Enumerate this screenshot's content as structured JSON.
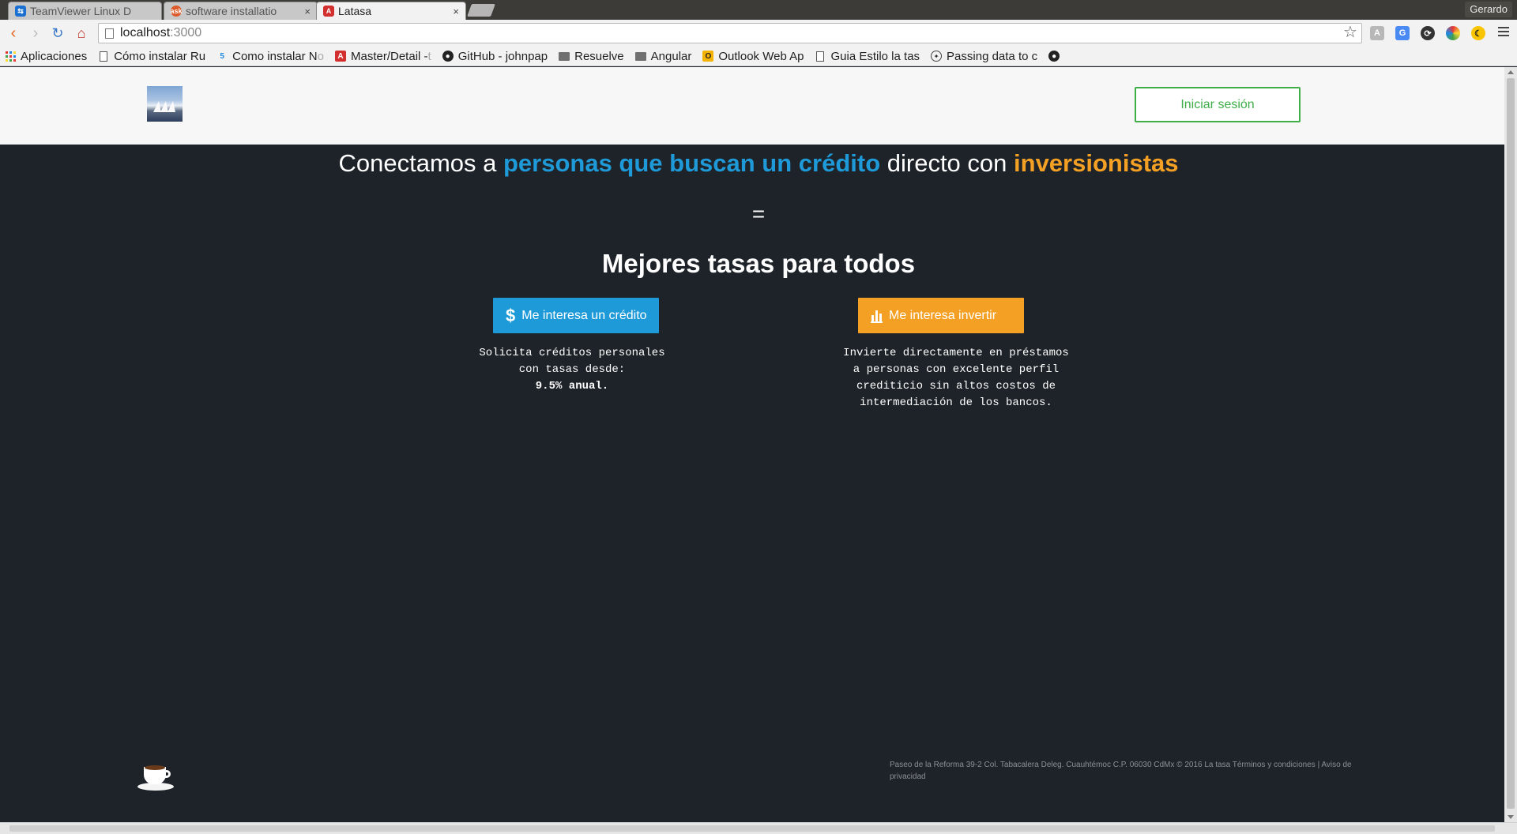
{
  "browser": {
    "tabs": [
      {
        "title": "TeamViewer Linux D",
        "icon": "teamviewer-icon",
        "active": false
      },
      {
        "title": "software installatio",
        "icon": "askubuntu-icon",
        "active": false
      },
      {
        "title": "Latasa",
        "icon": "angular-icon",
        "active": true
      }
    ],
    "tab_close": "×",
    "user": "Gerardo",
    "url_host": "localhost",
    "url_port": ":3000",
    "bookmarks": [
      {
        "label": "Aplicaciones",
        "faded": "",
        "icon": "apps-grid-icon"
      },
      {
        "label": "Cómo instalar Ru",
        "faded": "",
        "icon": "page-icon"
      },
      {
        "label": "Como instalar N",
        "faded": "o",
        "icon": "bookmark-icon"
      },
      {
        "label": "Master/Detail - ",
        "faded": "t",
        "icon": "angular-icon"
      },
      {
        "label": "GitHub - johnpap",
        "faded": "",
        "icon": "github-icon"
      },
      {
        "label": "Resuelve",
        "faded": "",
        "icon": "folder-icon"
      },
      {
        "label": "Angular",
        "faded": "",
        "icon": "folder-icon"
      },
      {
        "label": "Outlook Web Ap",
        "faded": "",
        "icon": "outlook-icon"
      },
      {
        "label": "Guia Estilo la tas",
        "faded": "",
        "icon": "page-icon"
      },
      {
        "label": "Passing data to c",
        "faded": "",
        "icon": "bookmark-icon"
      }
    ]
  },
  "header": {
    "login_label": "Iniciar sesión"
  },
  "hero": {
    "line_prefix": "Conectamos a ",
    "highlight_credit": "personas que buscan un crédito",
    "line_middle": " directo con ",
    "highlight_invest": "inversionistas",
    "equals": "=",
    "subhead": "Mejores tasas para todos"
  },
  "credit": {
    "button_label": "Me interesa un crédito",
    "icon_glyph": "$",
    "desc_text": "Solicita créditos personales\ncon tasas desde:",
    "desc_rate": "9.5% anual."
  },
  "invest": {
    "button_label": "Me interesa invertir",
    "desc_text": "Invierte directamente en préstamos\na personas con excelente perfil\ncrediticio sin altos costos de\nintermediación de los bancos."
  },
  "footer": {
    "address": "Paseo de la Reforma 39-2 Col. Tabacalera Deleg. Cuauhtémoc C.P. 06030 CdMx © 2016 La tasa ",
    "terms": "Términos y condiciones",
    "separator": " | ",
    "privacy": "Aviso de privacidad"
  },
  "colors": {
    "accent_blue": "#1e9ad8",
    "accent_orange": "#f4a024",
    "login_green": "#3fae49",
    "page_bg": "#1e2329"
  }
}
